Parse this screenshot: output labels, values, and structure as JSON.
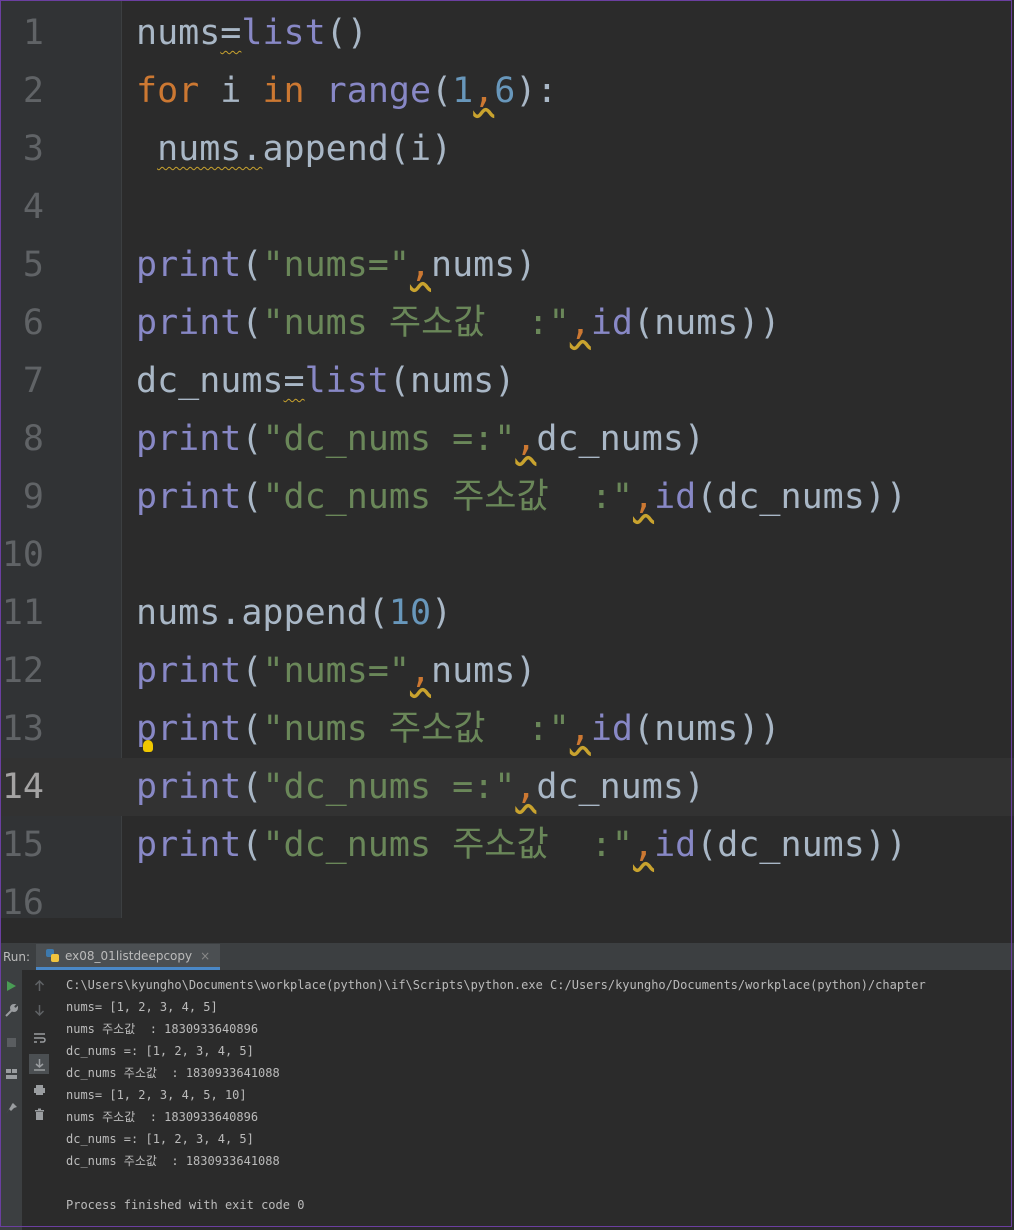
{
  "editor": {
    "current_line": 14,
    "lines": [
      {
        "num": "1",
        "tokens": [
          {
            "t": "nums",
            "c": "tok-default"
          },
          {
            "t": "=",
            "c": "tok-default tok-squiggle"
          },
          {
            "t": "list",
            "c": "tok-builtin"
          },
          {
            "t": "()",
            "c": "tok-default"
          }
        ]
      },
      {
        "num": "2",
        "tokens": [
          {
            "t": "for ",
            "c": "tok-kw"
          },
          {
            "t": "i ",
            "c": "tok-default"
          },
          {
            "t": "in ",
            "c": "tok-kw"
          },
          {
            "t": "range",
            "c": "tok-builtin"
          },
          {
            "t": "(",
            "c": "tok-default"
          },
          {
            "t": "1",
            "c": "tok-num"
          },
          {
            "t": ",",
            "c": "tok-warn"
          },
          {
            "t": "6",
            "c": "tok-num"
          },
          {
            "t": "):",
            "c": "tok-default"
          }
        ]
      },
      {
        "num": "3",
        "tokens": [
          {
            "t": " ",
            "c": "tok-default"
          },
          {
            "t": "nums.",
            "c": "tok-default tok-squiggle"
          },
          {
            "t": "append(i)",
            "c": "tok-default"
          }
        ]
      },
      {
        "num": "4",
        "tokens": []
      },
      {
        "num": "5",
        "tokens": [
          {
            "t": "print",
            "c": "tok-builtin"
          },
          {
            "t": "(",
            "c": "tok-default"
          },
          {
            "t": "\"nums=\"",
            "c": "tok-str"
          },
          {
            "t": ",",
            "c": "tok-warn"
          },
          {
            "t": "nums)",
            "c": "tok-default"
          }
        ]
      },
      {
        "num": "6",
        "tokens": [
          {
            "t": "print",
            "c": "tok-builtin"
          },
          {
            "t": "(",
            "c": "tok-default"
          },
          {
            "t": "\"nums 주소값  :\"",
            "c": "tok-str"
          },
          {
            "t": ",",
            "c": "tok-warn"
          },
          {
            "t": "id",
            "c": "tok-builtin"
          },
          {
            "t": "(nums))",
            "c": "tok-default"
          }
        ]
      },
      {
        "num": "7",
        "tokens": [
          {
            "t": "dc_nums",
            "c": "tok-default"
          },
          {
            "t": "=",
            "c": "tok-default tok-squiggle"
          },
          {
            "t": "list",
            "c": "tok-builtin"
          },
          {
            "t": "(nums)",
            "c": "tok-default"
          }
        ]
      },
      {
        "num": "8",
        "tokens": [
          {
            "t": "print",
            "c": "tok-builtin"
          },
          {
            "t": "(",
            "c": "tok-default"
          },
          {
            "t": "\"dc_nums =:\"",
            "c": "tok-str"
          },
          {
            "t": ",",
            "c": "tok-warn"
          },
          {
            "t": "dc_nums)",
            "c": "tok-default"
          }
        ]
      },
      {
        "num": "9",
        "tokens": [
          {
            "t": "print",
            "c": "tok-builtin"
          },
          {
            "t": "(",
            "c": "tok-default"
          },
          {
            "t": "\"dc_nums 주소값  :\"",
            "c": "tok-str"
          },
          {
            "t": ",",
            "c": "tok-warn"
          },
          {
            "t": "id",
            "c": "tok-builtin"
          },
          {
            "t": "(dc_nums))",
            "c": "tok-default"
          }
        ]
      },
      {
        "num": "10",
        "tokens": []
      },
      {
        "num": "11",
        "tokens": [
          {
            "t": "nums.append(",
            "c": "tok-default"
          },
          {
            "t": "10",
            "c": "tok-num"
          },
          {
            "t": ")",
            "c": "tok-default"
          }
        ]
      },
      {
        "num": "12",
        "tokens": [
          {
            "t": "print",
            "c": "tok-builtin"
          },
          {
            "t": "(",
            "c": "tok-default"
          },
          {
            "t": "\"nums=\"",
            "c": "tok-str"
          },
          {
            "t": ",",
            "c": "tok-warn"
          },
          {
            "t": "nums)",
            "c": "tok-default"
          }
        ]
      },
      {
        "num": "13",
        "tokens": [
          {
            "t": "print",
            "c": "tok-builtin"
          },
          {
            "t": "(",
            "c": "tok-default"
          },
          {
            "t": "\"nums 주소값  :\"",
            "c": "tok-str"
          },
          {
            "t": ",",
            "c": "tok-warn"
          },
          {
            "t": "id",
            "c": "tok-builtin"
          },
          {
            "t": "(nums))",
            "c": "tok-default"
          }
        ]
      },
      {
        "num": "14",
        "tokens": [
          {
            "t": "print",
            "c": "tok-builtin"
          },
          {
            "t": "(",
            "c": "tok-default"
          },
          {
            "t": "\"dc_nums =:\"",
            "c": "tok-str"
          },
          {
            "t": ",",
            "c": "tok-warn"
          },
          {
            "t": "dc_nums)",
            "c": "tok-default"
          }
        ]
      },
      {
        "num": "15",
        "tokens": [
          {
            "t": "print",
            "c": "tok-builtin"
          },
          {
            "t": "(",
            "c": "tok-default"
          },
          {
            "t": "\"dc_nums 주소값  :\"",
            "c": "tok-str"
          },
          {
            "t": ",",
            "c": "tok-warn"
          },
          {
            "t": "id",
            "c": "tok-builtin"
          },
          {
            "t": "(dc_nums))",
            "c": "tok-default"
          }
        ]
      },
      {
        "num": "16",
        "tokens": []
      }
    ]
  },
  "run_panel": {
    "label": "Run:",
    "tab_label": "ex08_01listdeepcopy",
    "tab_close": "×",
    "console_lines": [
      "C:\\Users\\kyungho\\Documents\\workplace(python)\\if\\Scripts\\python.exe C:/Users/kyungho/Documents/workplace(python)/chapter",
      "nums= [1, 2, 3, 4, 5]",
      "nums 주소값  : 1830933640896",
      "dc_nums =: [1, 2, 3, 4, 5]",
      "dc_nums 주소값  : 1830933641088",
      "nums= [1, 2, 3, 4, 5, 10]",
      "nums 주소값  : 1830933640896",
      "dc_nums =: [1, 2, 3, 4, 5]",
      "dc_nums 주소값  : 1830933641088",
      "",
      "Process finished with exit code 0"
    ]
  },
  "icons": {
    "run": "play-icon",
    "tool": "wrench-icon",
    "stop": "stop-icon",
    "layout": "layout-icon",
    "pin": "pin-icon",
    "up": "arrow-up-icon",
    "down": "arrow-down-icon",
    "wrap": "soft-wrap-icon",
    "scroll": "scroll-to-end-icon",
    "print": "print-icon",
    "trash": "trash-icon",
    "bulb": "lightbulb-icon"
  },
  "colors": {
    "keyword": "#cc7832",
    "builtin": "#8888c6",
    "string": "#6a8759",
    "number": "#6897bb",
    "text": "#a9b7c6",
    "run_green": "#499c54"
  }
}
